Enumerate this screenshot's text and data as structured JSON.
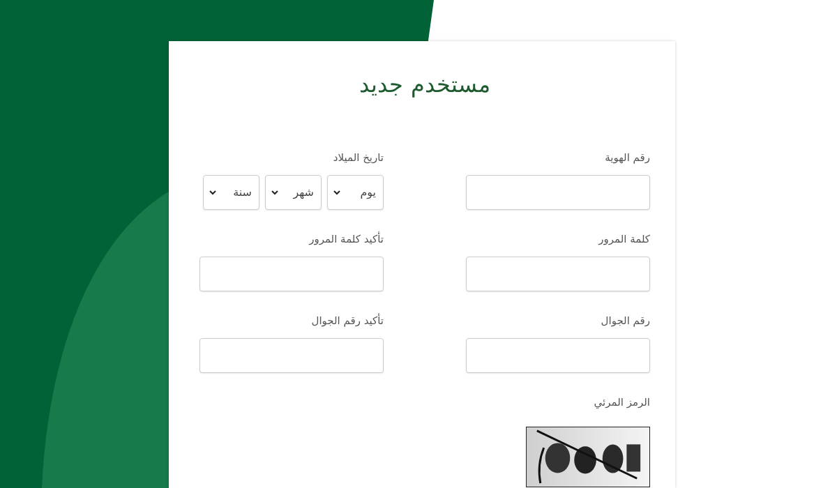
{
  "form": {
    "title": "مستخدم جديد",
    "fields": [
      {
        "kind": "text",
        "label": "رقم الهوية"
      },
      {
        "kind": "date",
        "label": "تاريخ الميلاد",
        "selects": [
          {
            "value": "يوم"
          },
          {
            "value": "شهر"
          },
          {
            "value": "سنة"
          }
        ]
      },
      {
        "kind": "text",
        "label": "كلمة المرور"
      },
      {
        "kind": "text",
        "label": "تأكيد كلمة المرور"
      },
      {
        "kind": "text",
        "label": "رقم الجوال"
      },
      {
        "kind": "text",
        "label": "تأكيد رقم الجوال"
      },
      {
        "kind": "captcha",
        "label": "الرمز المرئي"
      }
    ]
  }
}
